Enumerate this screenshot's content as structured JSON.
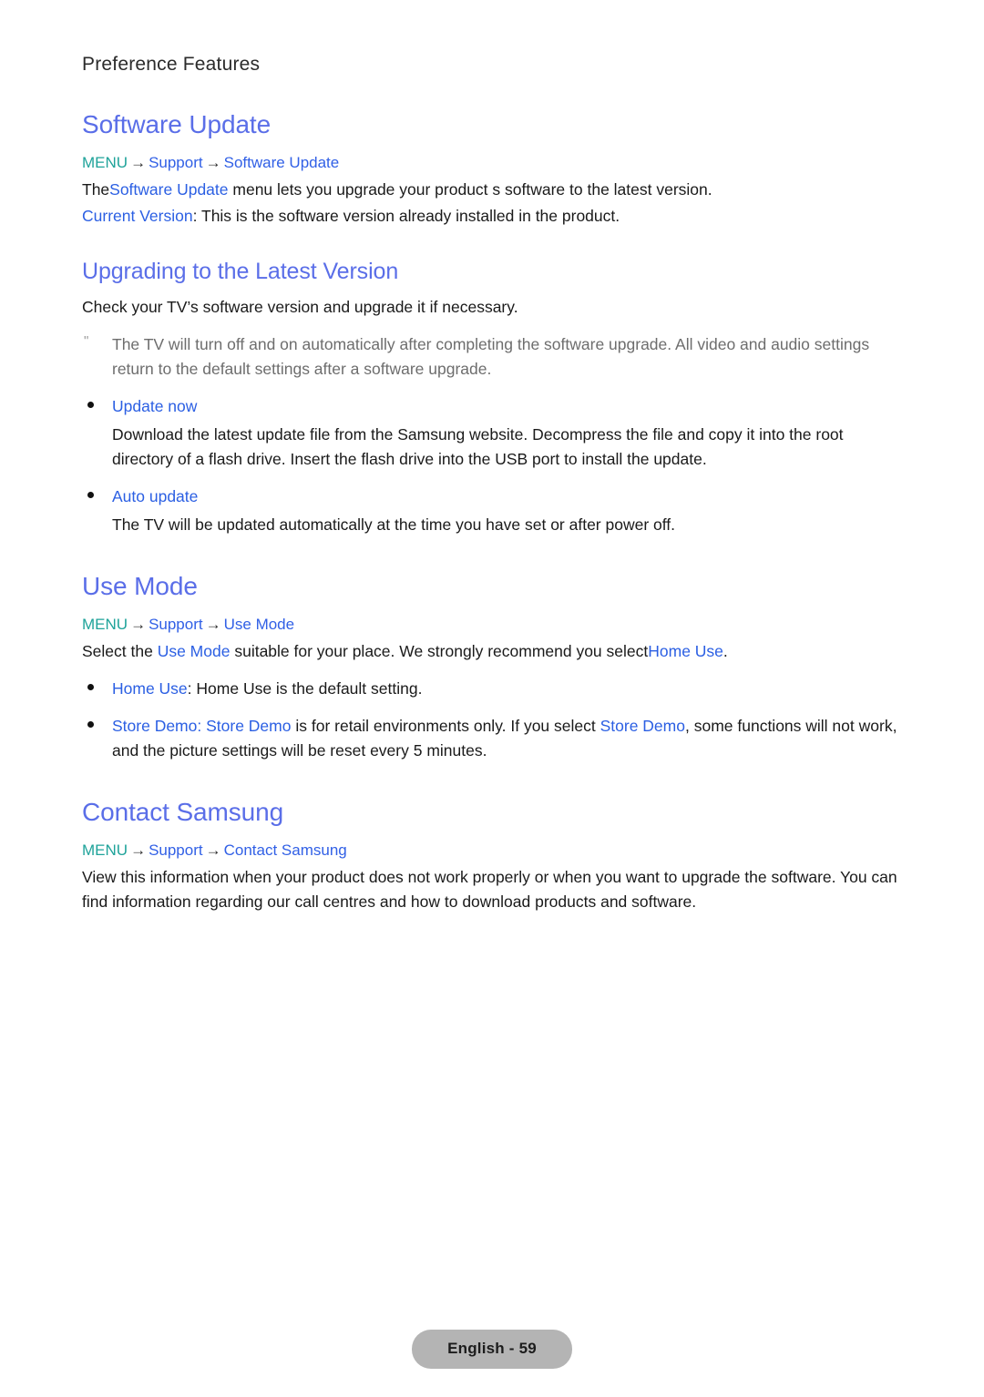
{
  "page": {
    "running_header": "Preference Features",
    "footer_label": "English - 59"
  },
  "colors": {
    "heading_blue": "#5a6ee8",
    "link_blue": "#2b5fe3",
    "menu_teal": "#1fa39a",
    "note_gray": "#6d6d6d",
    "footer_pill_bg": "#b4b4b4"
  },
  "breadcrumb_tokens": {
    "menu": "MENU",
    "support": "Support",
    "arrow": "→"
  },
  "sections": {
    "software_update": {
      "title": "Software Update",
      "breadcrumb_last": "Software Update",
      "line1_pre": "The",
      "line1_link": "Software Update",
      "line1_post": " menu lets you upgrade your product s software to the latest version.",
      "line2_link": "Current Version",
      "line2_post": ": This is the software version already installed in the product."
    },
    "upgrading": {
      "title": "Upgrading to the Latest Version",
      "intro": "Check your TV’s software version and upgrade it if necessary.",
      "note_marker": "\"",
      "note": "The TV will turn off and on automatically after completing the software upgrade. All video and audio settings return to the default settings after a software upgrade.",
      "bullets": [
        {
          "label": "Update now",
          "body": "Download the latest update file from the Samsung website. Decompress the file and copy it into the root directory of a flash drive. Insert the flash drive into the USB port to install the update."
        },
        {
          "label": "Auto update",
          "body": "The TV will be updated automatically at the time you have set or after power off."
        }
      ]
    },
    "use_mode": {
      "title": "Use Mode",
      "breadcrumb_last": "Use Mode",
      "intro_pre": "Select the ",
      "intro_link1": "Use Mode",
      "intro_mid": " suitable for your place. We strongly recommend you select",
      "intro_link2": "Home Use",
      "intro_post": ".",
      "bullet1_link": "Home Use",
      "bullet1_text": ": Home Use is the default setting.",
      "bullet2_link1": "Store Demo",
      "bullet2_sep": ": ",
      "bullet2_link2": "Store Demo",
      "bullet2_mid": " is for retail environments only. If you select ",
      "bullet2_link3": "Store Demo",
      "bullet2_post": ", some functions will not work, and the picture settings will be reset every 5 minutes."
    },
    "contact_samsung": {
      "title": "Contact Samsung",
      "breadcrumb_last": "Contact Samsung",
      "body": "View this information when your product does not work properly or when you want to upgrade the software. You can find information regarding our call centres and how to download products and software."
    }
  }
}
